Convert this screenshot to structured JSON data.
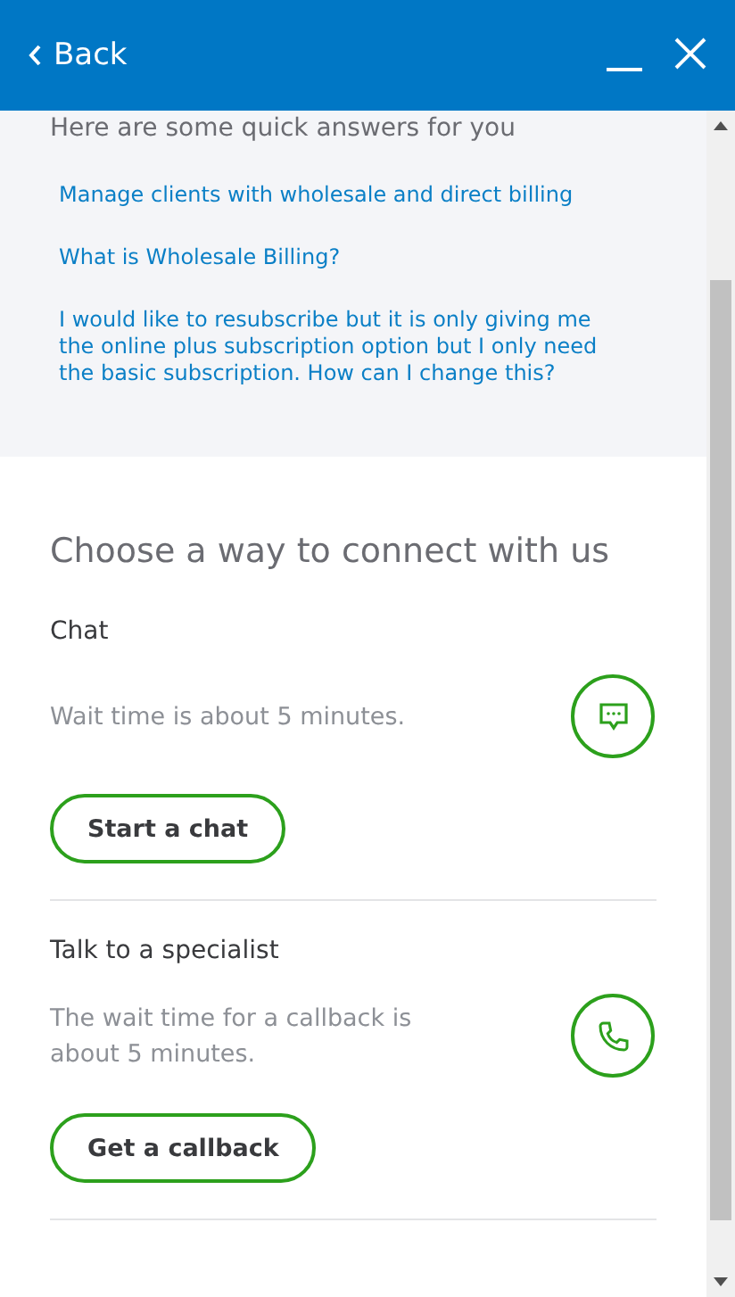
{
  "header": {
    "back": "Back"
  },
  "quick_answers": {
    "title": "Here are some quick answers for you",
    "links": [
      "Manage clients with wholesale and direct billing",
      "What is Wholesale Billing?",
      "I would like to resubscribe but it is only giving me the online plus subscription option but I only need the basic subscription. How can I change this?"
    ]
  },
  "connect": {
    "title": "Choose a way to connect with us",
    "options": [
      {
        "kind": "chat",
        "title": "Chat",
        "description": "Wait time is about 5 minutes.",
        "button": "Start a chat"
      },
      {
        "kind": "phone",
        "title": "Talk to a specialist",
        "description": "The wait time for a callback is about 5 minutes.",
        "button": "Get a callback"
      }
    ]
  }
}
